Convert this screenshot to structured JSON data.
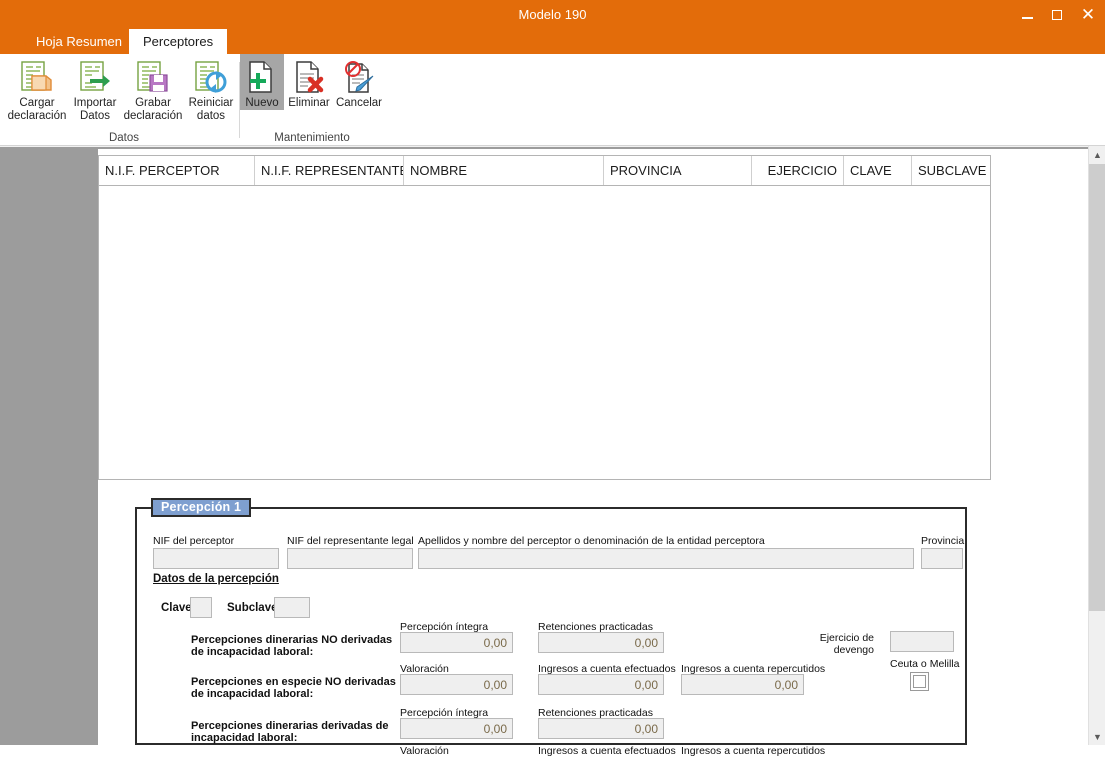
{
  "window": {
    "title": "Modelo 190",
    "minimize_label": "Minimizar",
    "maximize_label": "Maximizar",
    "close_label": "✕"
  },
  "tabs": [
    {
      "label": "Hoja Resumen",
      "active": false
    },
    {
      "label": "Perceptores",
      "active": true
    }
  ],
  "ribbon": {
    "groups": [
      {
        "label": "Datos",
        "buttons": [
          {
            "label": "Cargar\ndeclaración",
            "icon": "load-declaration-icon",
            "selected": false
          },
          {
            "label": "Importar\nDatos",
            "icon": "import-data-icon",
            "selected": false
          },
          {
            "label": "Grabar\ndeclaración",
            "icon": "save-declaration-icon",
            "selected": false
          },
          {
            "label": "Reiniciar\ndatos",
            "icon": "reset-data-icon",
            "selected": false
          }
        ]
      },
      {
        "label": "Mantenimiento",
        "buttons": [
          {
            "label": "Nuevo",
            "icon": "new-record-icon",
            "selected": true
          },
          {
            "label": "Eliminar",
            "icon": "delete-record-icon",
            "selected": false
          },
          {
            "label": "Cancelar",
            "icon": "cancel-edit-icon",
            "selected": false
          }
        ]
      }
    ]
  },
  "grid": {
    "columns": [
      {
        "label": "N.I.F. PERCEPTOR",
        "align": "left"
      },
      {
        "label": "N.I.F. REPRESENTANTE",
        "align": "left"
      },
      {
        "label": "NOMBRE",
        "align": "left"
      },
      {
        "label": "PROVINCIA",
        "align": "left"
      },
      {
        "label": "EJERCICIO",
        "align": "right"
      },
      {
        "label": "CLAVE",
        "align": "left"
      },
      {
        "label": "SUBCLAVE",
        "align": "left"
      }
    ],
    "rows": []
  },
  "form": {
    "legend": "Percepción 1",
    "nif_perceptor_label": "NIF del perceptor",
    "nif_perceptor_value": "",
    "nif_representante_label": "NIF del representante legal",
    "nif_representante_value": "",
    "nombre_label": "Apellidos y nombre del perceptor o denominación de la entidad perceptora",
    "nombre_value": "",
    "provincia_label": "Provincia",
    "provincia_value": "",
    "section_title": "Datos de la percepción",
    "clave_label": "Clave:",
    "clave_value": "",
    "subclave_label": "Subclave:",
    "subclave_value": "",
    "ejercicio_devengo_label": "Ejercicio de\ndevengo",
    "ejercicio_devengo_value": "",
    "ceuta_melilla_label": "Ceuta o Melilla",
    "ceuta_melilla_checked": false,
    "rows": [
      {
        "label": "Percepciones dinerarias NO derivadas de incapacidad laboral:",
        "fields": [
          {
            "label": "Percepción íntegra",
            "value": "0,00"
          },
          {
            "label": "Retenciones practicadas",
            "value": "0,00"
          }
        ]
      },
      {
        "label": "Percepciones en especie NO derivadas de incapacidad laboral:",
        "fields": [
          {
            "label": "Valoración",
            "value": "0,00"
          },
          {
            "label": "Ingresos a cuenta efectuados",
            "value": "0,00"
          },
          {
            "label": "Ingresos a cuenta repercutidos",
            "value": "0,00"
          }
        ]
      },
      {
        "label": "Percepciones dinerarias derivadas de incapacidad laboral:",
        "fields": [
          {
            "label": "Percepción íntegra",
            "value": "0,00"
          },
          {
            "label": "Retenciones practicadas",
            "value": "0,00"
          }
        ]
      },
      {
        "label": "",
        "fields": [
          {
            "label": "Valoración",
            "value": ""
          },
          {
            "label": "Ingresos a cuenta efectuados",
            "value": ""
          },
          {
            "label": "Ingresos a cuenta repercutidos",
            "value": ""
          }
        ]
      }
    ]
  },
  "scrollbar": {
    "up_label": "▲",
    "down_label": "▼"
  },
  "colors": {
    "accent": "#e36c0a",
    "legend_blue": "#7e9fd0",
    "workspace_gray": "#9c9c9c"
  }
}
